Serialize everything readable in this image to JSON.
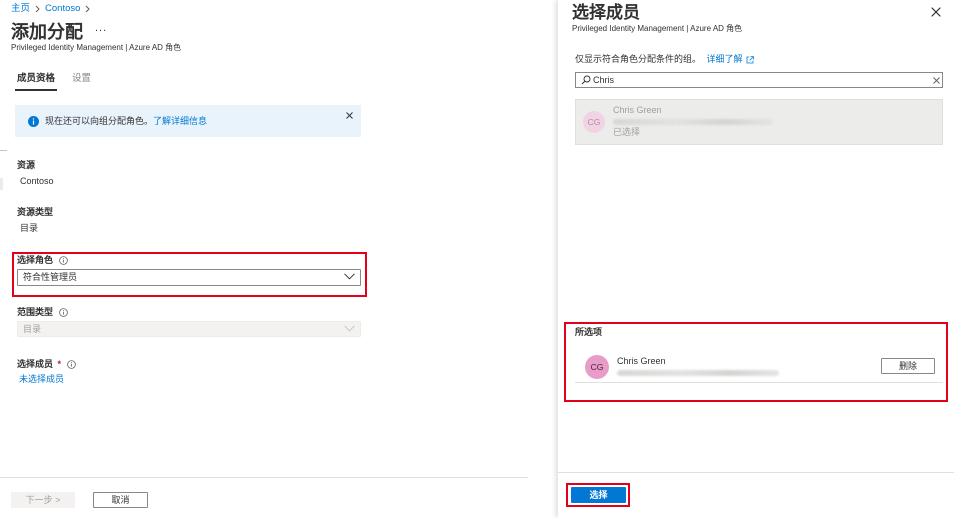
{
  "breadcrumb": {
    "home": "主页",
    "current": "Contoso"
  },
  "header": {
    "title": "添加分配",
    "more": "...",
    "subtitle": "Privileged Identity Management | Azure AD 角色"
  },
  "tabs": [
    {
      "label": "成员资格",
      "active": true
    },
    {
      "label": "设置",
      "active": false
    }
  ],
  "info_banner": {
    "text": "现在还可以向组分配角色。",
    "link": "了解详细信息"
  },
  "form": {
    "resource": {
      "label": "资源",
      "value": "Contoso"
    },
    "resource_type": {
      "label": "资源类型",
      "value": "目录"
    },
    "role": {
      "label": "选择角色",
      "value": "符合性管理员"
    },
    "scope_type": {
      "label": "范围类型",
      "value": "目录",
      "disabled": true
    },
    "members": {
      "label": "选择成员",
      "required_mark": "*",
      "link": "未选择成员"
    }
  },
  "footer": {
    "next_label": "下一步 >",
    "next_disabled": true,
    "cancel_label": "取消"
  },
  "panel": {
    "title": "选择成员",
    "subtitle": "Privileged Identity Management | Azure AD 角色",
    "hint": "仅显示符合角色分配条件的组。",
    "learn_more": "详细了解",
    "search": {
      "value": "Chris"
    },
    "results": [
      {
        "initials": "CG",
        "name": "Chris Green",
        "status": "已选择",
        "selected": true
      }
    ],
    "selected_heading": "所选项",
    "selected": [
      {
        "initials": "CG",
        "name": "Chris Green",
        "remove_label": "删除"
      }
    ],
    "select_label": "选择"
  },
  "icons": {
    "breadcrumb_separator": "chevron-right-icon",
    "banner": "info-icon",
    "banner_close": "close-icon",
    "field_hint": "info-outline-icon",
    "dropdown": "chevron-down-icon",
    "panel_close": "close-icon",
    "external_link": "external-link-icon",
    "search": "search-icon",
    "search_clear": "close-icon"
  },
  "colors": {
    "accent": "#0078d4",
    "highlight": "#e3001b",
    "avatar": "#e89cc8",
    "avatar_text": "#4b1736",
    "text": "#323130",
    "muted": "#a19f9d",
    "info_bg": "#e9f3fc"
  }
}
